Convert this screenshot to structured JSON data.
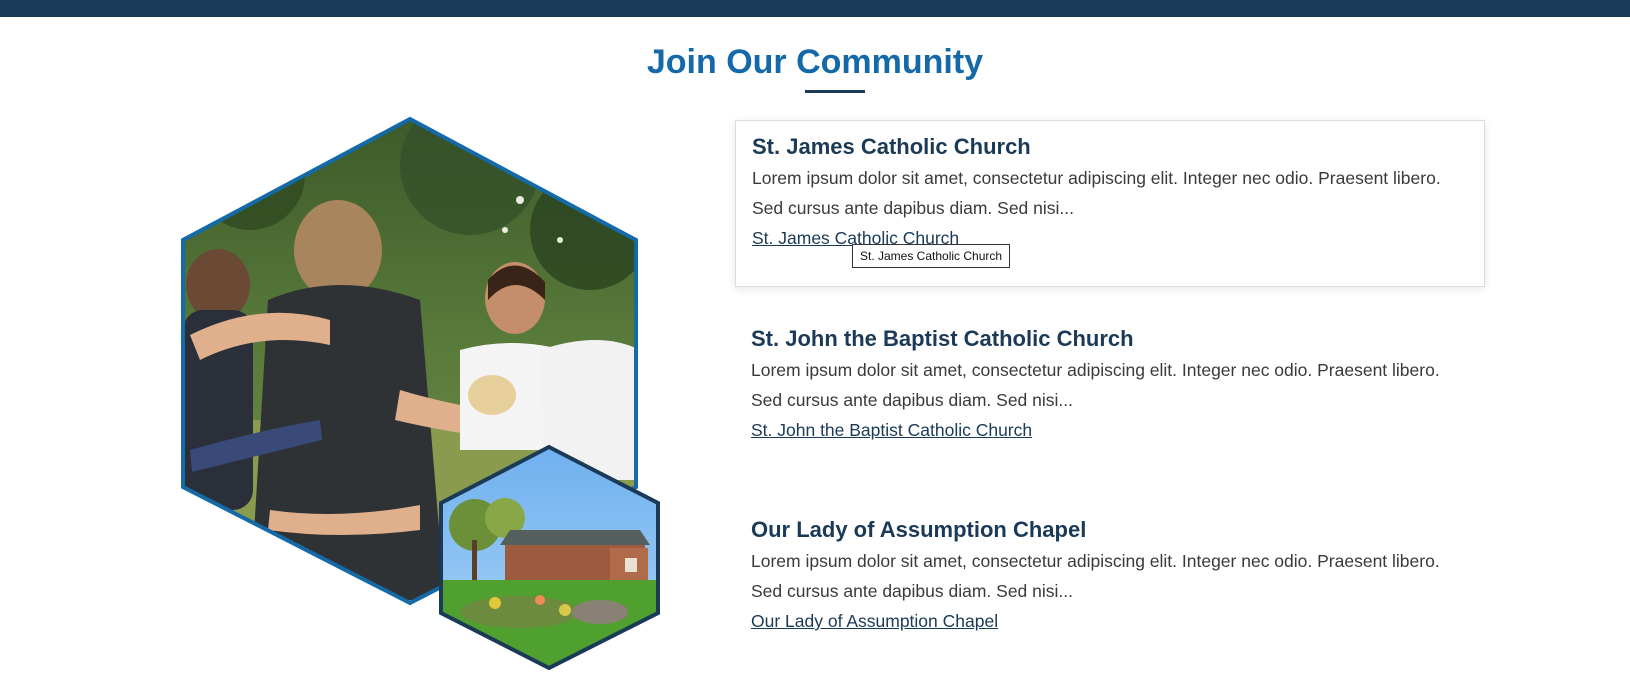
{
  "section": {
    "title": "Join Our Community"
  },
  "churches": [
    {
      "name": "St. James Catholic Church",
      "description": "Lorem ipsum dolor sit amet, consectetur adipiscing elit. Integer nec odio. Praesent libero. Sed cursus ante dapibus diam. Sed nisi...",
      "link_label": "St. James Catholic Church"
    },
    {
      "name": "St. John the Baptist Catholic Church",
      "description": "Lorem ipsum dolor sit amet, consectetur adipiscing elit. Integer nec odio. Praesent libero. Sed cursus ante dapibus diam. Sed nisi...",
      "link_label": "St. John the Baptist Catholic Church"
    },
    {
      "name": "Our Lady of Assumption Chapel",
      "description": "Lorem ipsum dolor sit amet, consectetur adipiscing elit. Integer nec odio. Praesent libero. Sed cursus ante dapibus diam. Sed nisi...",
      "link_label": "Our Lady of Assumption Chapel"
    }
  ],
  "tooltip": {
    "text": "St. James Catholic Church"
  },
  "images": {
    "main": "community-group-photo",
    "secondary": "church-building-photo"
  },
  "colors": {
    "header_bar": "#1b3a57",
    "accent_blue": "#1469a8",
    "navy": "#1b3a57",
    "body_text": "#3a3a3a"
  }
}
